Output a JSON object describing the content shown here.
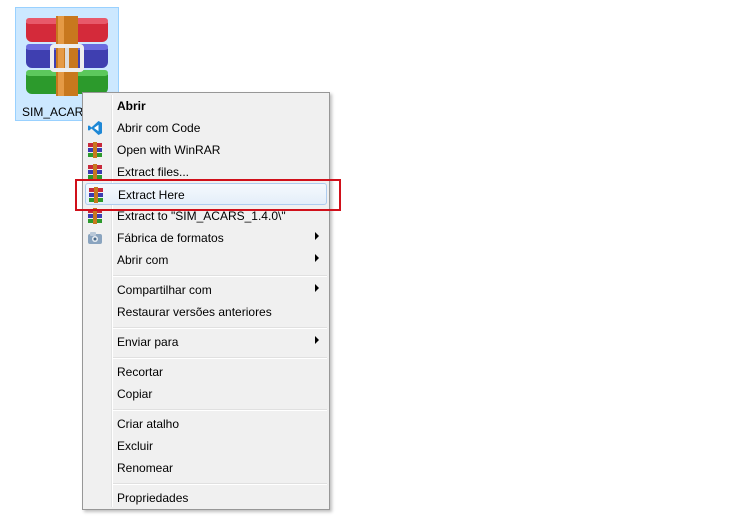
{
  "file": {
    "name": "SIM_ACARS_1.4.0",
    "label_visible": "SIM_ACARS"
  },
  "colors": {
    "highlight": "#d0101a",
    "selection": "#cce8ff"
  },
  "menu": {
    "items": [
      {
        "label": "Abrir",
        "icon": "none",
        "bold": true,
        "submenu": false
      },
      {
        "label": "Abrir com Code",
        "icon": "vscode-icon",
        "submenu": false
      },
      {
        "label": "Open with WinRAR",
        "icon": "winrar-icon",
        "submenu": false
      },
      {
        "label": "Extract files...",
        "icon": "winrar-icon",
        "submenu": false
      },
      {
        "label": "Extract Here",
        "icon": "winrar-icon",
        "submenu": false,
        "highlighted": true
      },
      {
        "label": "Extract to \"SIM_ACARS_1.4.0\\\"",
        "icon": "winrar-icon",
        "submenu": false
      },
      {
        "label": "Fábrica de formatos",
        "icon": "format-factory-icon",
        "submenu": true
      },
      {
        "label": "Abrir com",
        "icon": "none",
        "submenu": true
      },
      {
        "label": "Compartilhar com",
        "icon": "none",
        "submenu": true
      },
      {
        "label": "Restaurar versões anteriores",
        "icon": "none",
        "submenu": false
      },
      {
        "label": "Enviar para",
        "icon": "none",
        "submenu": true
      },
      {
        "label": "Recortar",
        "icon": "none",
        "submenu": false
      },
      {
        "label": "Copiar",
        "icon": "none",
        "submenu": false
      },
      {
        "label": "Criar atalho",
        "icon": "none",
        "submenu": false
      },
      {
        "label": "Excluir",
        "icon": "none",
        "submenu": false
      },
      {
        "label": "Renomear",
        "icon": "none",
        "submenu": false
      },
      {
        "label": "Propriedades",
        "icon": "none",
        "submenu": false
      }
    ]
  }
}
